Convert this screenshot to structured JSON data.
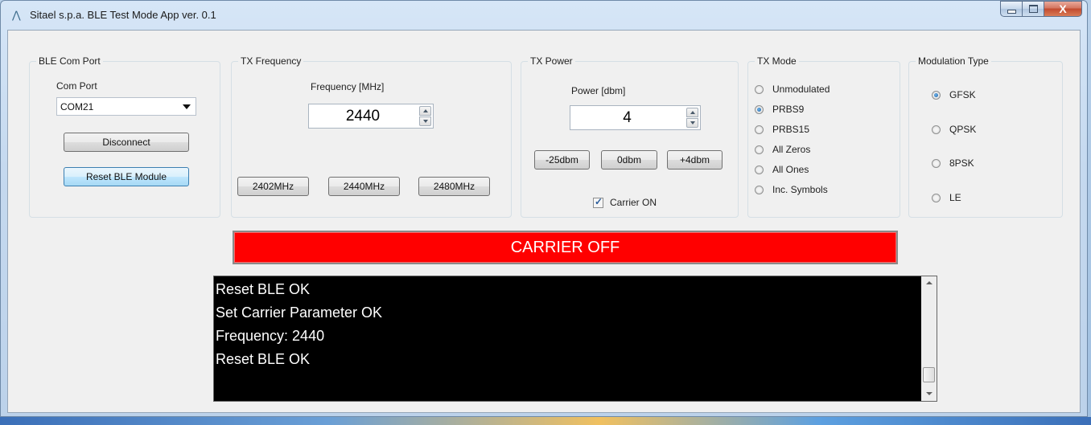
{
  "window": {
    "title": "Sitael s.p.a. BLE Test Mode App ver. 0.1",
    "app_icon": "triangle-app-icon",
    "caption": {
      "minimize_icon": "minimize-icon",
      "maximize_icon": "maximize-icon",
      "close_icon": "close-icon",
      "close_glyph": "X"
    }
  },
  "com_port": {
    "group_label": "BLE Com Port",
    "field_label": "Com Port",
    "selected": "COM21",
    "disconnect_label": "Disconnect",
    "reset_label": "Reset BLE Module"
  },
  "tx_frequency": {
    "group_label": "TX Frequency",
    "field_label": "Frequency [MHz]",
    "value": "2440",
    "presets": [
      "2402MHz",
      "2440MHz",
      "2480MHz"
    ]
  },
  "tx_power": {
    "group_label": "TX Power",
    "field_label": "Power [dbm]",
    "value": "4",
    "presets": [
      "-25dbm",
      "0dbm",
      "+4dbm"
    ],
    "carrier_checkbox_label": "Carrier ON",
    "carrier_checked": true
  },
  "tx_mode": {
    "group_label": "TX Mode",
    "options": [
      "Unmodulated",
      "PRBS9",
      "PRBS15",
      "All Zeros",
      "All Ones",
      "Inc. Symbols"
    ],
    "selected": "PRBS9"
  },
  "modulation": {
    "group_label": "Modulation Type",
    "options": [
      "GFSK",
      "QPSK",
      "8PSK",
      "LE"
    ],
    "selected": "GFSK"
  },
  "status": {
    "text": "CARRIER OFF",
    "color": "#ff0000"
  },
  "log": {
    "lines": [
      "Reset BLE OK",
      "Set Carrier Parameter OK",
      "Frequency: 2440",
      "Reset BLE OK"
    ]
  }
}
